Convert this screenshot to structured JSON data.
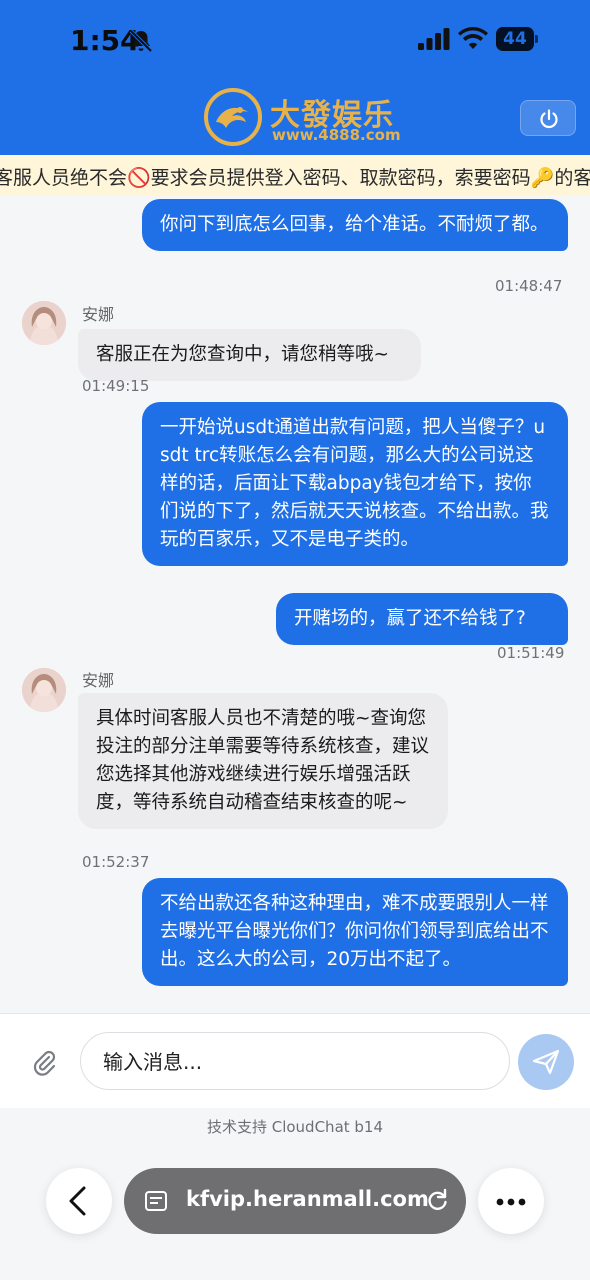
{
  "status_bar": {
    "time": "1:54",
    "battery": "44"
  },
  "header": {
    "brand_name": "大發娱乐",
    "brand_url": "www.4888.com"
  },
  "marquee": {
    "text": "客服人员绝不会🚫要求会员提供登入密码、取款密码，索要密码🔑的客服都"
  },
  "messages": [
    {
      "from": "user",
      "text": "你问下到底怎么回事，给个准话。不耐烦了都。",
      "time": "01:48:47"
    },
    {
      "from": "agent",
      "name": "安娜",
      "text": "客服正在为您查询中，请您稍等哦~",
      "time": "01:49:15"
    },
    {
      "from": "user",
      "text": "一开始说usdt通道出款有问题，把人当傻子？usdt trc转账怎么会有问题，那么大的公司说这样的话，后面让下载abpay钱包才给下，按你们说的下了，然后就天天说核查。不给出款。我玩的百家乐，又不是电子类的。",
      "time": ""
    },
    {
      "from": "user",
      "text": "开赌场的，赢了还不给钱了?",
      "time": "01:51:49"
    },
    {
      "from": "agent",
      "name": "安娜",
      "text": "具体时间客服人员也不清楚的哦~查询您投注的部分注单需要等待系统核查，建议您选择其他游戏继续进行娱乐增强活跃度，等待系统自动稽查结束核查的呢~",
      "time": "01:52:37"
    },
    {
      "from": "user",
      "text": "不给出款还各种这种理由，难不成要跟别人一样去曝光平台曝光你们？你问你们领导到底给出不出。这么大的公司，20万出不起了。",
      "time": ""
    }
  ],
  "composer": {
    "placeholder": "输入消息..."
  },
  "footer": {
    "powered_by": "技术支持 CloudChat b14"
  },
  "browser": {
    "url": "kfvip.heranmall.com"
  },
  "colors": {
    "primary": "#1f6fe6",
    "brand_gold": "#e8b24a",
    "agent_bubble": "#ececef",
    "marquee_bg": "#fff6d9"
  }
}
